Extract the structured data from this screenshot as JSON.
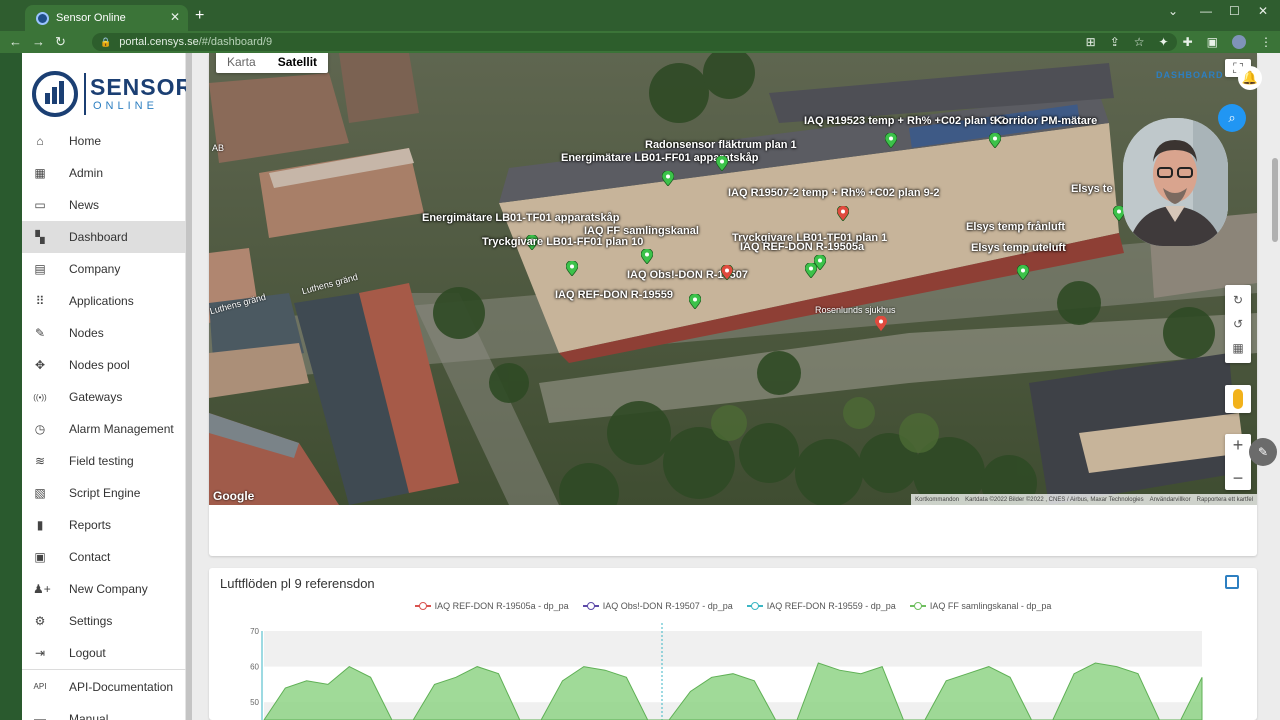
{
  "browser": {
    "tab_title": "Sensor Online",
    "url_host": "portal.censys.se",
    "url_path": "/#/dashboard/9"
  },
  "logo": {
    "line1": "SENSOR",
    "line2": "ONLINE"
  },
  "sidebar": {
    "items": [
      {
        "label": "Home",
        "icon": "home-icon"
      },
      {
        "label": "Admin",
        "icon": "admin-icon"
      },
      {
        "label": "News",
        "icon": "news-icon"
      },
      {
        "label": "Dashboard",
        "icon": "dashboard-icon",
        "active": true
      },
      {
        "label": "Company",
        "icon": "company-icon"
      },
      {
        "label": "Applications",
        "icon": "applications-icon"
      },
      {
        "label": "Nodes",
        "icon": "nodes-icon"
      },
      {
        "label": "Nodes pool",
        "icon": "nodes-pool-icon"
      },
      {
        "label": "Gateways",
        "icon": "gateways-icon"
      },
      {
        "label": "Alarm Management",
        "icon": "alarm-icon"
      },
      {
        "label": "Field testing",
        "icon": "field-testing-icon"
      },
      {
        "label": "Script Engine",
        "icon": "script-icon"
      },
      {
        "label": "Reports",
        "icon": "reports-icon"
      },
      {
        "label": "Contact",
        "icon": "contact-icon"
      },
      {
        "label": "New Company",
        "icon": "new-company-icon"
      },
      {
        "label": "Settings",
        "icon": "settings-icon"
      },
      {
        "label": "Logout",
        "icon": "logout-icon"
      },
      {
        "label": "API-Documentation",
        "icon": "api-icon"
      },
      {
        "label": "Manual",
        "icon": "manual-icon"
      }
    ]
  },
  "map": {
    "toggle_map": "Karta",
    "toggle_satellite": "Satellit",
    "google": "Google",
    "footer": [
      "Kortkommandon",
      "Kartdata ©2022 Bilder ©2022 , CNES / Airbus, Maxar Technologies",
      "Användarvillkor",
      "Rapportera ett kartfel"
    ],
    "street_labels": [
      "Luthens gränd",
      "Luthens gränd",
      "Rosenlunds sjukhus",
      "AB"
    ],
    "sensors": [
      "IAQ R19523 temp + Rh% +C02 plan 9-2",
      "Korridor PM-mätare",
      "Radonsensor fläktrum plan 1",
      "Energimätare LB01-FF01 apparatskåp",
      "IAQ R19507-2 temp + Rh% +C02 plan 9-2",
      "Elsys te",
      "Energimätare LB01-TF01 apparatskåp",
      "IAQ FF samlingskanal",
      "Elsys temp frånluft",
      "Tryckgivare LB01-TF01 plan 1",
      "Tryckgivare LB01-FF01 plan 10",
      "IAQ REF-DON R-19505a",
      "Elsys temp uteluft",
      "IAQ Obs!-DON R-19507",
      "IAQ REF-DON R-19559"
    ]
  },
  "header": {
    "dashboard_link": "DASHBOARD"
  },
  "chart": {
    "title": "Luftflöden pl 9 referensdon",
    "legend": [
      {
        "name": "IAQ REF-DON R-19505a - dp_pa",
        "color": "#d9534f"
      },
      {
        "name": "IAQ Obs!-DON R-19507 - dp_pa",
        "color": "#5c4aa8"
      },
      {
        "name": "IAQ REF-DON R-19559  - dp_pa",
        "color": "#3bb6c4"
      },
      {
        "name": "IAQ FF samlingskanal  - dp_pa",
        "color": "#6fbf5f"
      }
    ]
  },
  "chart_data": {
    "type": "area",
    "series": [
      {
        "name": "IAQ FF samlingskanal  - dp_pa",
        "values": [
          0,
          54,
          56,
          55,
          60,
          57,
          0,
          0,
          55,
          57,
          60,
          58,
          0,
          0,
          56,
          60,
          59,
          57,
          0,
          0,
          53,
          57,
          58,
          56,
          0,
          0,
          61,
          59,
          58,
          60,
          0,
          0,
          56,
          58,
          60,
          57,
          0,
          0,
          58,
          61,
          60,
          58,
          0,
          0,
          57
        ]
      }
    ],
    "yticks": [
      "70",
      "60",
      "50"
    ],
    "ylim": [
      45,
      70
    ]
  }
}
